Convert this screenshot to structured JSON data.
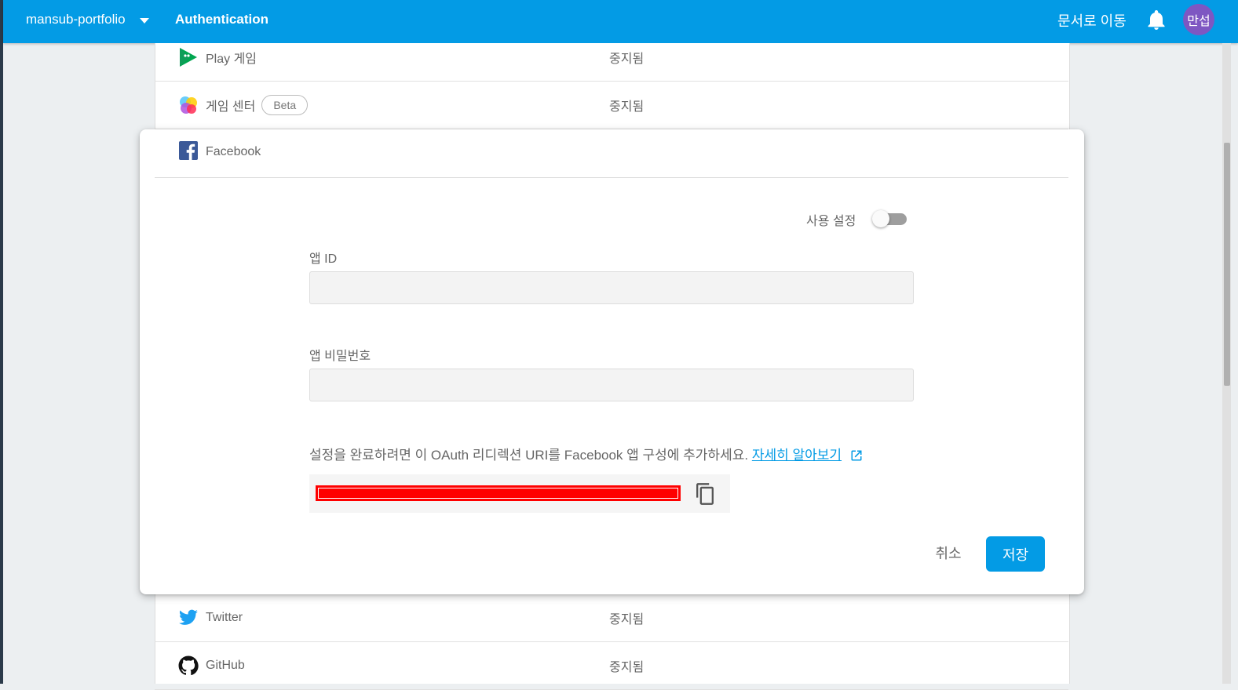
{
  "header": {
    "project_name": "mansub-portfolio",
    "section_title": "Authentication",
    "docs_link": "문서로 이동",
    "avatar_text": "만섭"
  },
  "colors": {
    "topbar": "#039be5",
    "accent": "#039be5",
    "avatar": "#7e57c2",
    "redaction": "#ff0000"
  },
  "providers_above": [
    {
      "name": "Play 게임",
      "status": "중지됨",
      "icon": "play-games-icon"
    },
    {
      "name": "게임 센터",
      "badge": "Beta",
      "status": "중지됨",
      "icon": "game-center-icon"
    }
  ],
  "facebook_panel": {
    "name": "Facebook",
    "icon": "facebook-icon",
    "enable_label": "사용 설정",
    "enabled": false,
    "app_id_label": "앱 ID",
    "app_id_value": "",
    "app_secret_label": "앱 비밀번호",
    "app_secret_value": "",
    "note_text": "설정을 완료하려면 이 OAuth 리디렉션 URI를 Facebook 앱 구성에 추가하세요.",
    "learn_more": "자세히 알아보기",
    "cancel_label": "취소",
    "save_label": "저장"
  },
  "providers_below": [
    {
      "name": "Twitter",
      "status": "중지됨",
      "icon": "twitter-icon"
    },
    {
      "name": "GitHub",
      "status": "중지됨",
      "icon": "github-icon"
    }
  ]
}
